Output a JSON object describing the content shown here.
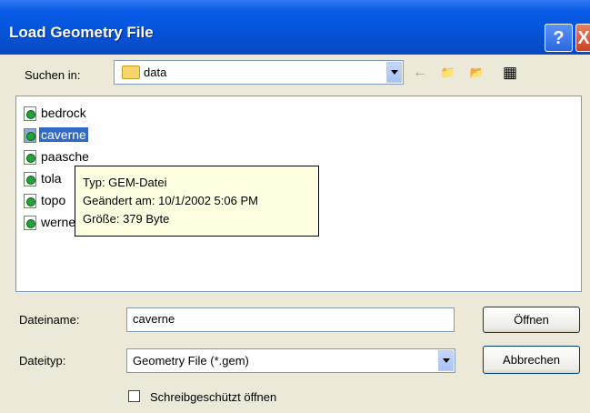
{
  "window": {
    "title": "Load Geometry File",
    "help_button": "?",
    "close_button": "X"
  },
  "lookin": {
    "label": "Suchen in:",
    "value": "data"
  },
  "toolbar": {
    "back_icon": "←",
    "up_icon": "📁",
    "new_folder_icon": "📂",
    "view_icon": "▦"
  },
  "files": [
    {
      "name": "bedrock"
    },
    {
      "name": "caverne"
    },
    {
      "name": "paasche"
    },
    {
      "name": "tola"
    },
    {
      "name": "topo"
    },
    {
      "name": "werner"
    }
  ],
  "tooltip": {
    "type": "Typ: GEM-Datei",
    "modified": "Geändert am: 10/1/2002 5:06 PM",
    "size": "Größe: 379 Byte"
  },
  "filename": {
    "label": "Dateiname:",
    "value": "caverne"
  },
  "filetype": {
    "label": "Dateityp:",
    "value": "Geometry File (*.gem)"
  },
  "buttons": {
    "open": "Öffnen",
    "cancel": "Abbrechen"
  },
  "readonly": {
    "label": "Schreibgeschützt öffnen",
    "checked": false
  }
}
